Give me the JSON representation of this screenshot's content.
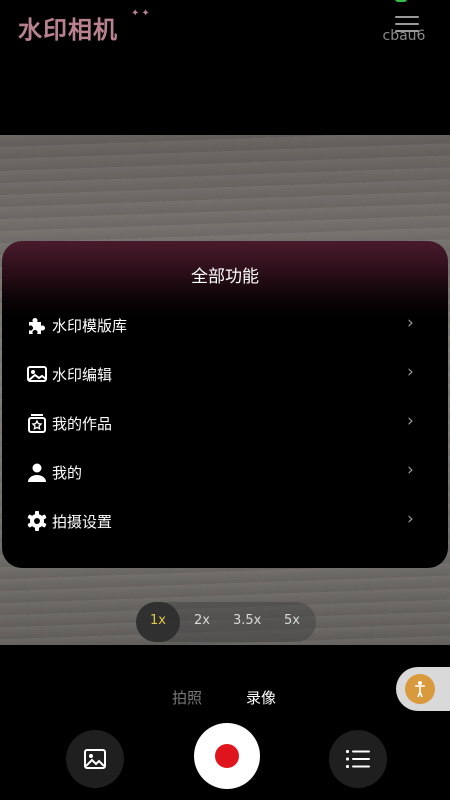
{
  "header": {
    "app_name": "水印相机",
    "menu_caption": "cbau6"
  },
  "panel": {
    "title": "全部功能",
    "items": [
      {
        "label": "水印模版库",
        "icon": "puzzle-icon"
      },
      {
        "label": "水印编辑",
        "icon": "image-edit-icon"
      },
      {
        "label": "我的作品",
        "icon": "works-box-icon"
      },
      {
        "label": "我的",
        "icon": "user-icon"
      },
      {
        "label": "拍摄设置",
        "icon": "gear-icon"
      }
    ],
    "chevron": "›"
  },
  "zoom": {
    "options": [
      "1x",
      "2x",
      "3.5x",
      "5x"
    ],
    "selected": "1x"
  },
  "modes": {
    "photo": "拍照",
    "video": "录像",
    "active": "录像"
  },
  "colors": {
    "logo": "#b9828f",
    "shutter_record": "#e0141c",
    "active_zoom": "#e0c84a",
    "panel_gradient_top": "#4a1a2c"
  },
  "icons": {
    "gallery": "gallery-icon",
    "list": "list-icon",
    "float": "accessibility-icon",
    "menu": "hamburger-menu-icon"
  }
}
